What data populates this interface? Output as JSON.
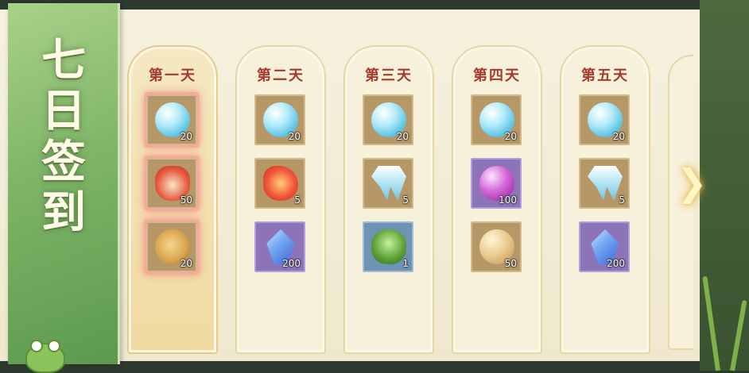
{
  "title": [
    "七",
    "日",
    "签",
    "到"
  ],
  "days": [
    {
      "label": "第一天",
      "active": true,
      "items": [
        {
          "icon": "water-orb-icon",
          "quantity": "20",
          "claimed": true
        },
        {
          "icon": "red-pouch-icon",
          "quantity": "50",
          "claimed": true
        },
        {
          "icon": "phoenix-medallion-icon",
          "quantity": "20",
          "claimed": true
        }
      ]
    },
    {
      "label": "第二天",
      "active": false,
      "items": [
        {
          "icon": "water-orb-icon",
          "quantity": "20"
        },
        {
          "icon": "fire-bird-icon",
          "quantity": "5"
        },
        {
          "icon": "blue-crystal-icon",
          "quantity": "200"
        }
      ]
    },
    {
      "label": "第三天",
      "active": false,
      "items": [
        {
          "icon": "water-orb-icon",
          "quantity": "20"
        },
        {
          "icon": "ice-jellyfish-icon",
          "quantity": "5"
        },
        {
          "icon": "herb-bundle-icon",
          "quantity": "1"
        }
      ]
    },
    {
      "label": "第四天",
      "active": false,
      "items": [
        {
          "icon": "water-orb-icon",
          "quantity": "20"
        },
        {
          "icon": "purple-pearl-icon",
          "quantity": "100"
        },
        {
          "icon": "gold-orb-icon",
          "quantity": "50"
        }
      ]
    },
    {
      "label": "第五天",
      "active": false,
      "items": [
        {
          "icon": "water-orb-icon",
          "quantity": "20"
        },
        {
          "icon": "ice-jellyfish-icon",
          "quantity": "5"
        },
        {
          "icon": "blue-crystal-icon",
          "quantity": "200"
        }
      ]
    }
  ],
  "colors": {
    "day_label": "#a53b2b",
    "panel_bg": "#f7f1dc",
    "banner_green": "#7fb568",
    "claimed_glow": "#f5a9a0"
  }
}
